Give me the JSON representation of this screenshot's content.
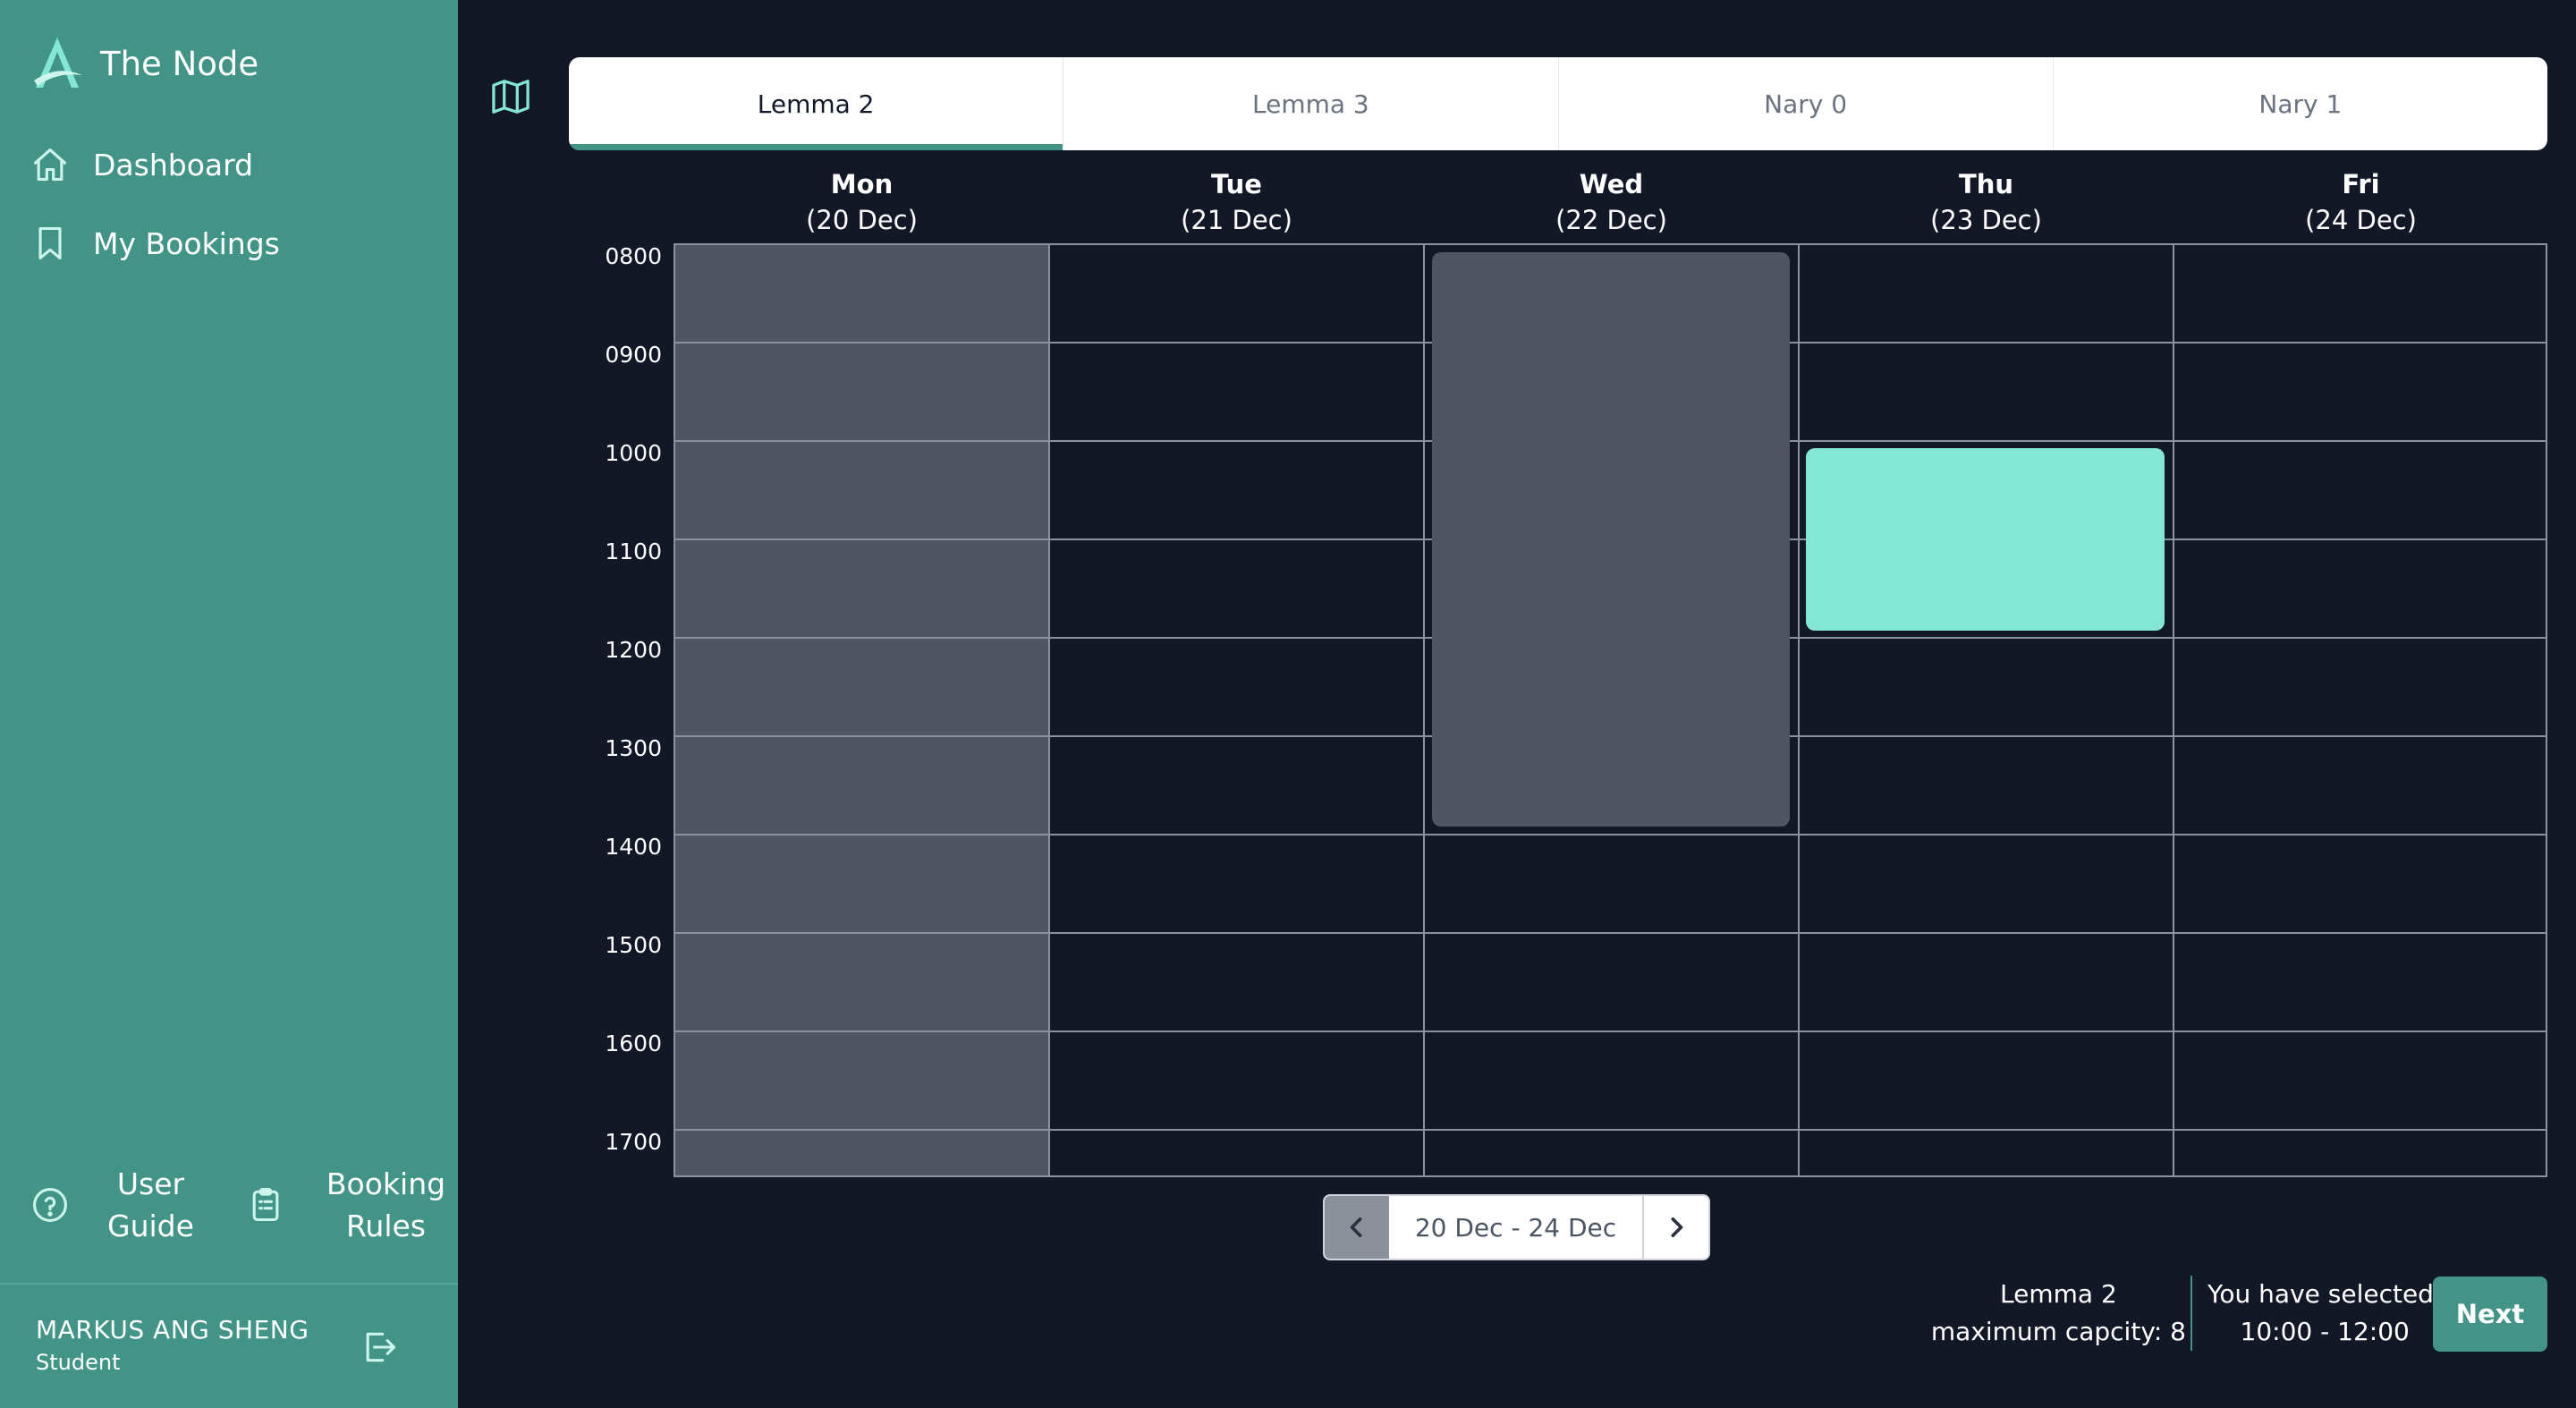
{
  "app": {
    "name": "The Node",
    "logo_icon": "the-node-logo-icon"
  },
  "sidebar": {
    "items": [
      {
        "label": "Dashboard",
        "icon": "home-icon"
      },
      {
        "label": "My Bookings",
        "icon": "bookmark-icon"
      }
    ],
    "bottom_links": [
      {
        "line1": "User",
        "line2": "Guide",
        "icon": "help-circle-icon"
      },
      {
        "line1": "Booking",
        "line2": "Rules",
        "icon": "clipboard-icon"
      }
    ],
    "user": {
      "name": "MARKUS ANG SHENG",
      "role": "Student"
    }
  },
  "tabs": [
    {
      "label": "Lemma 2",
      "active": true
    },
    {
      "label": "Lemma 3",
      "active": false
    },
    {
      "label": "Nary 0",
      "active": false
    },
    {
      "label": "Nary 1",
      "active": false
    }
  ],
  "calendar": {
    "days": [
      {
        "name": "Mon",
        "date": "(20 Dec)"
      },
      {
        "name": "Tue",
        "date": "(21 Dec)"
      },
      {
        "name": "Wed",
        "date": "(22 Dec)"
      },
      {
        "name": "Thu",
        "date": "(23 Dec)"
      },
      {
        "name": "Fri",
        "date": "(24 Dec)"
      }
    ],
    "times": [
      "0800",
      "0900",
      "1000",
      "1100",
      "1200",
      "1300",
      "1400",
      "1500",
      "1600",
      "1700"
    ],
    "blocks": [
      {
        "day": "Mon",
        "start": "0800",
        "end": "1730",
        "status": "unavailable"
      },
      {
        "day": "Wed",
        "start": "0800",
        "end": "1400",
        "status": "booked"
      },
      {
        "day": "Thu",
        "start": "1000",
        "end": "1200",
        "status": "selected"
      }
    ]
  },
  "pager": {
    "range": "20 Dec - 24 Dec"
  },
  "footer": {
    "room": "Lemma 2",
    "capacity": "maximum capcity: 8",
    "selected_label": "You have selected:",
    "selected_range": "10:00 - 12:00",
    "next_label": "Next"
  },
  "colors": {
    "sidebar": "#419486",
    "background": "#121826",
    "selected_slot": "#84e6d4",
    "unavailable_slot": "#4f5562"
  }
}
